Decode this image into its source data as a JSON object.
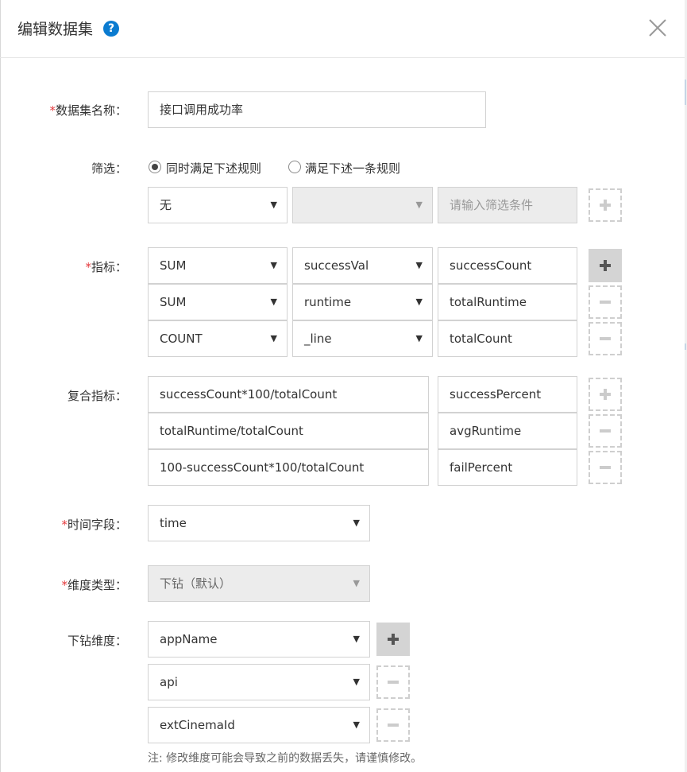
{
  "dialog": {
    "title": "编辑数据集"
  },
  "form": {
    "name": {
      "label": "数据集名称：",
      "value": "接口调用成功率"
    },
    "filter": {
      "label": "筛选：",
      "option_all": "同时满足下述规则",
      "option_any": "满足下述一条规则",
      "selected": "option_all",
      "rule": {
        "op": "无",
        "field": "",
        "placeholder": "请输入筛选条件"
      }
    },
    "metrics": {
      "label": "指标：",
      "rows": [
        {
          "agg": "SUM",
          "field": "successVal",
          "alias": "successCount"
        },
        {
          "agg": "SUM",
          "field": "runtime",
          "alias": "totalRuntime"
        },
        {
          "agg": "COUNT",
          "field": "_line",
          "alias": "totalCount"
        }
      ]
    },
    "composite": {
      "label": "复合指标：",
      "rows": [
        {
          "expr": "successCount*100/totalCount",
          "alias": "successPercent"
        },
        {
          "expr": "totalRuntime/totalCount",
          "alias": "avgRuntime"
        },
        {
          "expr": "100-successCount*100/totalCount",
          "alias": "failPercent"
        }
      ]
    },
    "time_field": {
      "label": "时间字段：",
      "value": "time"
    },
    "dim_type": {
      "label": "维度类型：",
      "value": "下钻（默认）"
    },
    "drill": {
      "label": "下钻维度：",
      "rows": [
        "appName",
        "api",
        "extCinemaId"
      ],
      "note": "注: 修改维度可能会导致之前的数据丢失，请谨慎修改。"
    }
  },
  "colors": {
    "accent": "#0a7bd0",
    "required": "#e4393c"
  }
}
